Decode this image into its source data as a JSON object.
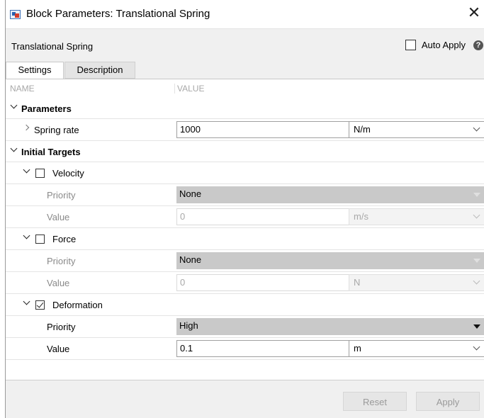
{
  "window": {
    "title": "Block Parameters: Translational Spring",
    "close_symbol": "✕"
  },
  "header": {
    "block_name": "Translational Spring",
    "auto_apply_label": "Auto Apply",
    "help_symbol": "?"
  },
  "tabs": [
    {
      "label": "Settings",
      "active": true
    },
    {
      "label": "Description",
      "active": false
    }
  ],
  "columns": {
    "name": "NAME",
    "value": "VALUE"
  },
  "parameters": {
    "section_label": "Parameters",
    "spring_rate": {
      "label": "Spring rate",
      "value": "1000",
      "unit": "N/m"
    }
  },
  "initial_targets": {
    "section_label": "Initial Targets",
    "velocity": {
      "label": "Velocity",
      "checked": false,
      "priority_label": "Priority",
      "priority": "None",
      "value_label": "Value",
      "value": "0",
      "unit": "m/s"
    },
    "force": {
      "label": "Force",
      "checked": false,
      "priority_label": "Priority",
      "priority": "None",
      "value_label": "Value",
      "value": "0",
      "unit": "N"
    },
    "deformation": {
      "label": "Deformation",
      "checked": true,
      "priority_label": "Priority",
      "priority": "High",
      "value_label": "Value",
      "value": "0.1",
      "unit": "m"
    }
  },
  "footer": {
    "reset_label": "Reset",
    "apply_label": "Apply"
  }
}
